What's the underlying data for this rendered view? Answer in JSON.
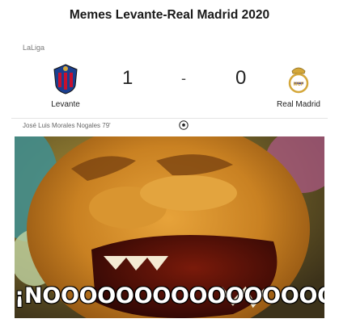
{
  "page": {
    "title": "Memes Levante-Real Madrid 2020"
  },
  "match": {
    "league": "LaLiga",
    "home_team": {
      "name": "Levante",
      "score": "1",
      "crest_icon": "levante-crest-icon"
    },
    "separator": "-",
    "away_team": {
      "name": "Real Madrid",
      "score": "0",
      "crest_icon": "real-madrid-crest-icon"
    },
    "goal_event": {
      "text": "José Luis Morales Nogales 79'",
      "icon": "soccer-ball-icon"
    }
  },
  "meme": {
    "caption": "¡NOOOOOOOOOOOOOOOO!"
  },
  "colors": {
    "levante_blue": "#1b3f8f",
    "levante_red": "#c8102e",
    "madrid_gold": "#d4a73a",
    "score_text": "#222222"
  }
}
